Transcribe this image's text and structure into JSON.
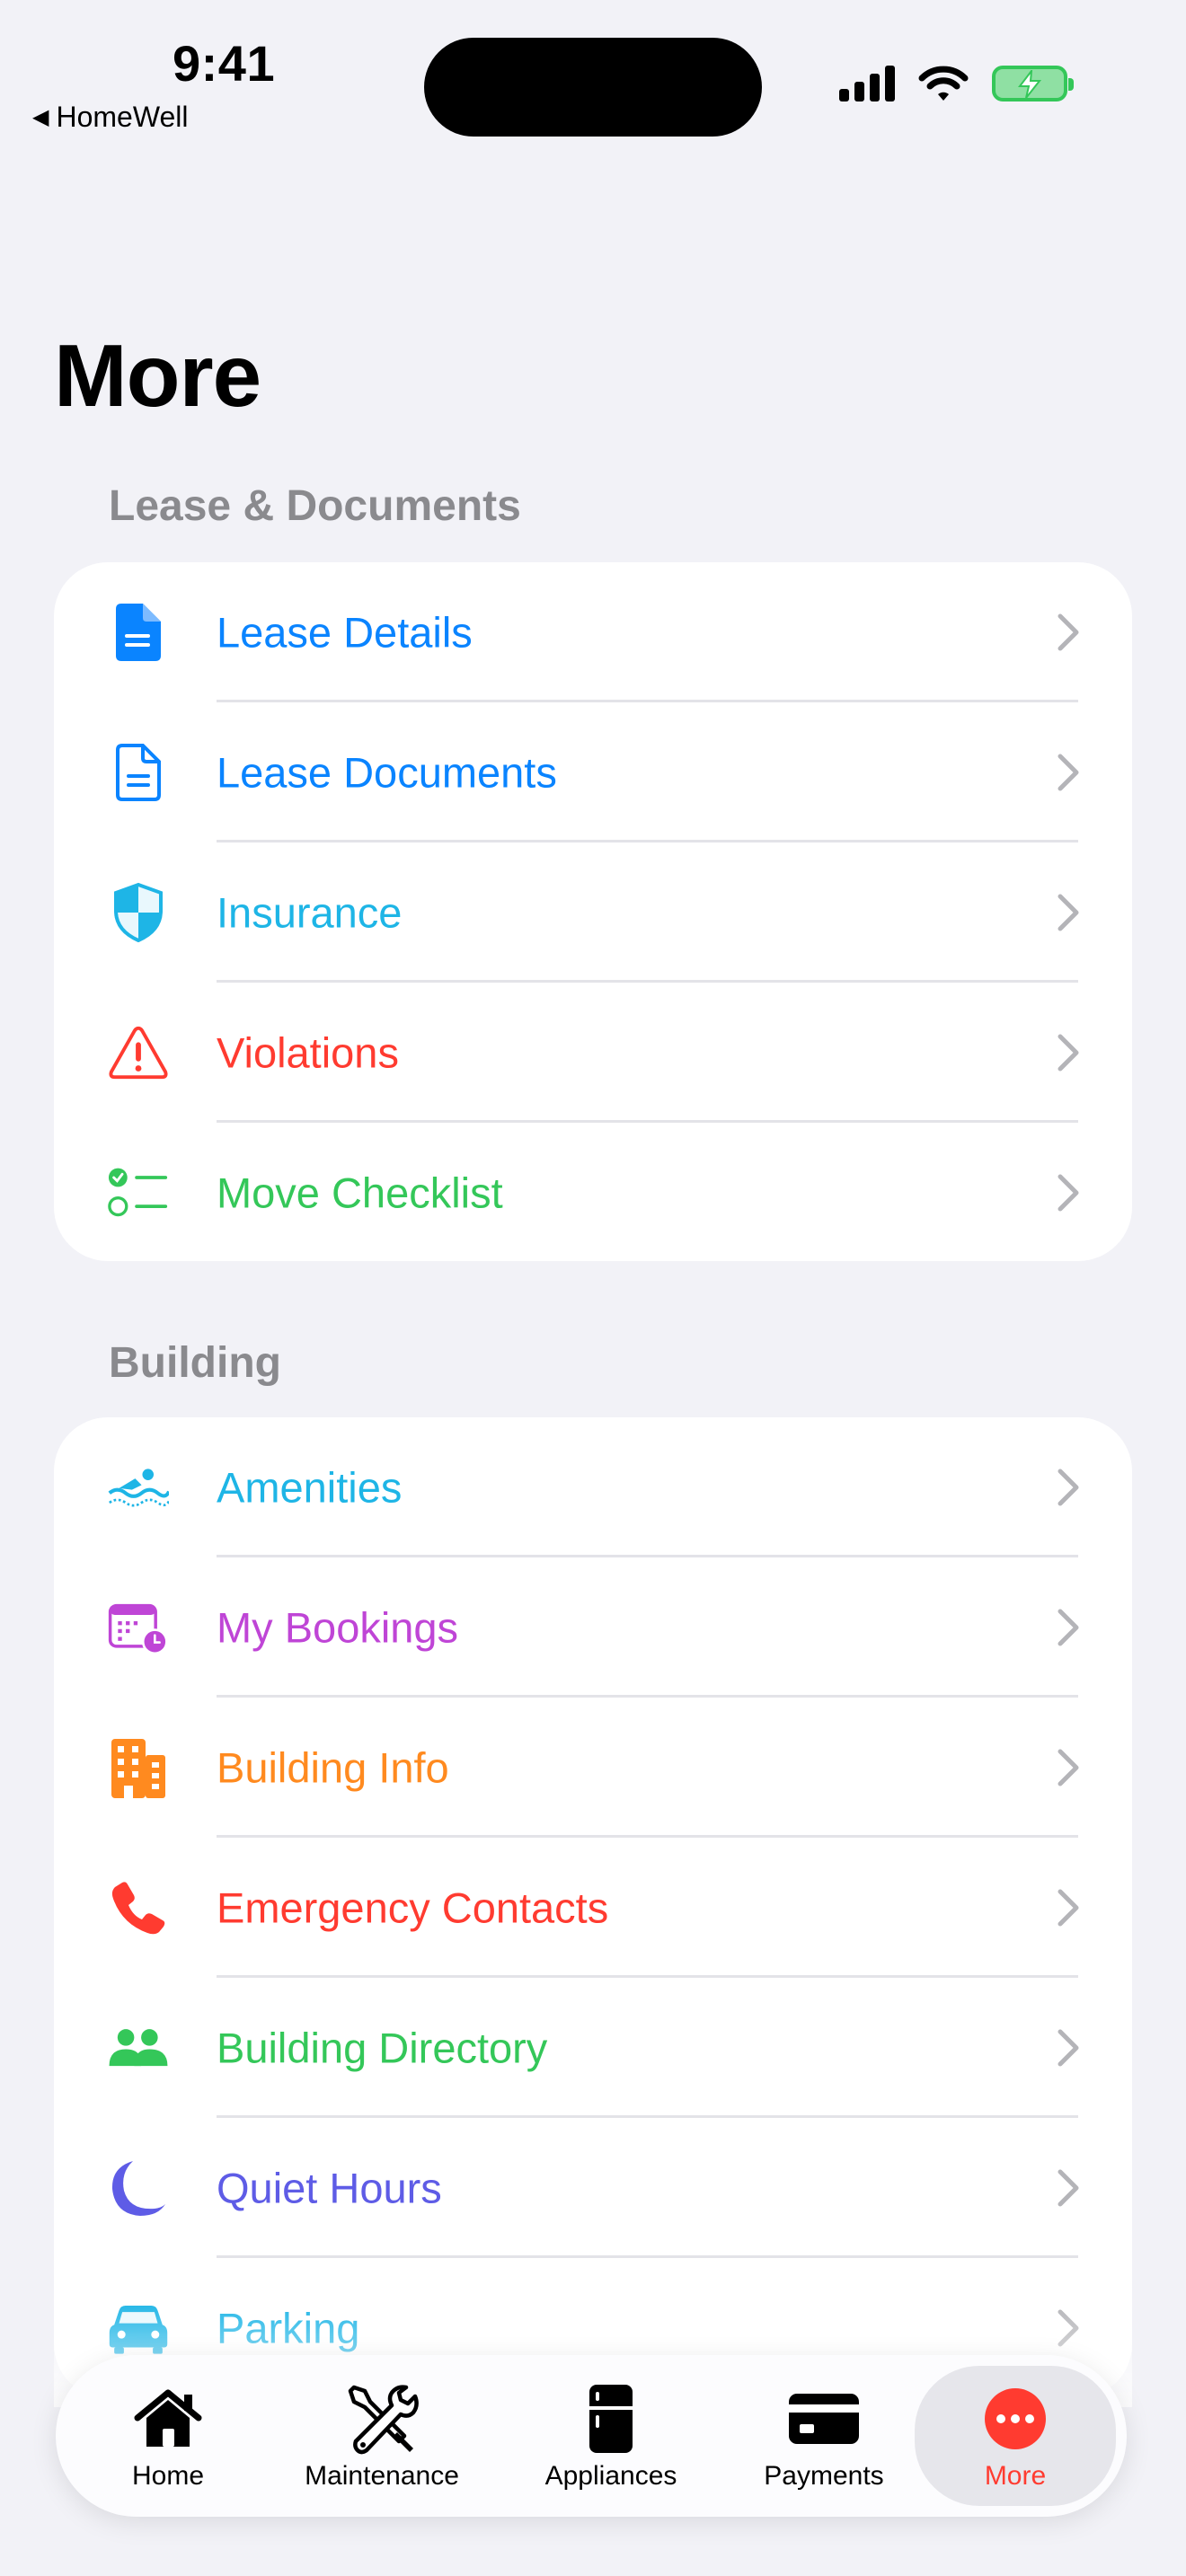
{
  "status_bar": {
    "time": "9:41",
    "back_app": "HomeWell"
  },
  "page": {
    "title": "More"
  },
  "sections": [
    {
      "header": "Lease & Documents",
      "items": [
        {
          "label": "Lease Details",
          "icon": "doc-filled-icon",
          "color": "#0A84FF"
        },
        {
          "label": "Lease Documents",
          "icon": "doc-outline-icon",
          "color": "#0A84FF"
        },
        {
          "label": "Insurance",
          "icon": "shield-icon",
          "color": "#1EB5E6"
        },
        {
          "label": "Violations",
          "icon": "warning-icon",
          "color": "#FF3B30"
        },
        {
          "label": "Move Checklist",
          "icon": "checklist-icon",
          "color": "#34C759"
        }
      ]
    },
    {
      "header": "Building",
      "items": [
        {
          "label": "Amenities",
          "icon": "swimming-icon",
          "color": "#1EB5E6"
        },
        {
          "label": "My Bookings",
          "icon": "calendar-clock-icon",
          "color": "#BF45D6"
        },
        {
          "label": "Building Info",
          "icon": "building-icon",
          "color": "#FF8A1F"
        },
        {
          "label": "Emergency Contacts",
          "icon": "phone-icon",
          "color": "#FF3B30"
        },
        {
          "label": "Building Directory",
          "icon": "people-icon",
          "color": "#34C759"
        },
        {
          "label": "Quiet Hours",
          "icon": "moon-icon",
          "color": "#5E5CE6"
        },
        {
          "label": "Parking",
          "icon": "car-icon",
          "color": "#1EB5E6"
        }
      ]
    }
  ],
  "tab_bar": [
    {
      "label": "Home",
      "icon": "house-icon"
    },
    {
      "label": "Maintenance",
      "icon": "tools-icon"
    },
    {
      "label": "Appliances",
      "icon": "fridge-icon"
    },
    {
      "label": "Payments",
      "icon": "credit-card-icon"
    },
    {
      "label": "More",
      "icon": "more-icon",
      "active": true,
      "color": "#FF3B30"
    }
  ]
}
